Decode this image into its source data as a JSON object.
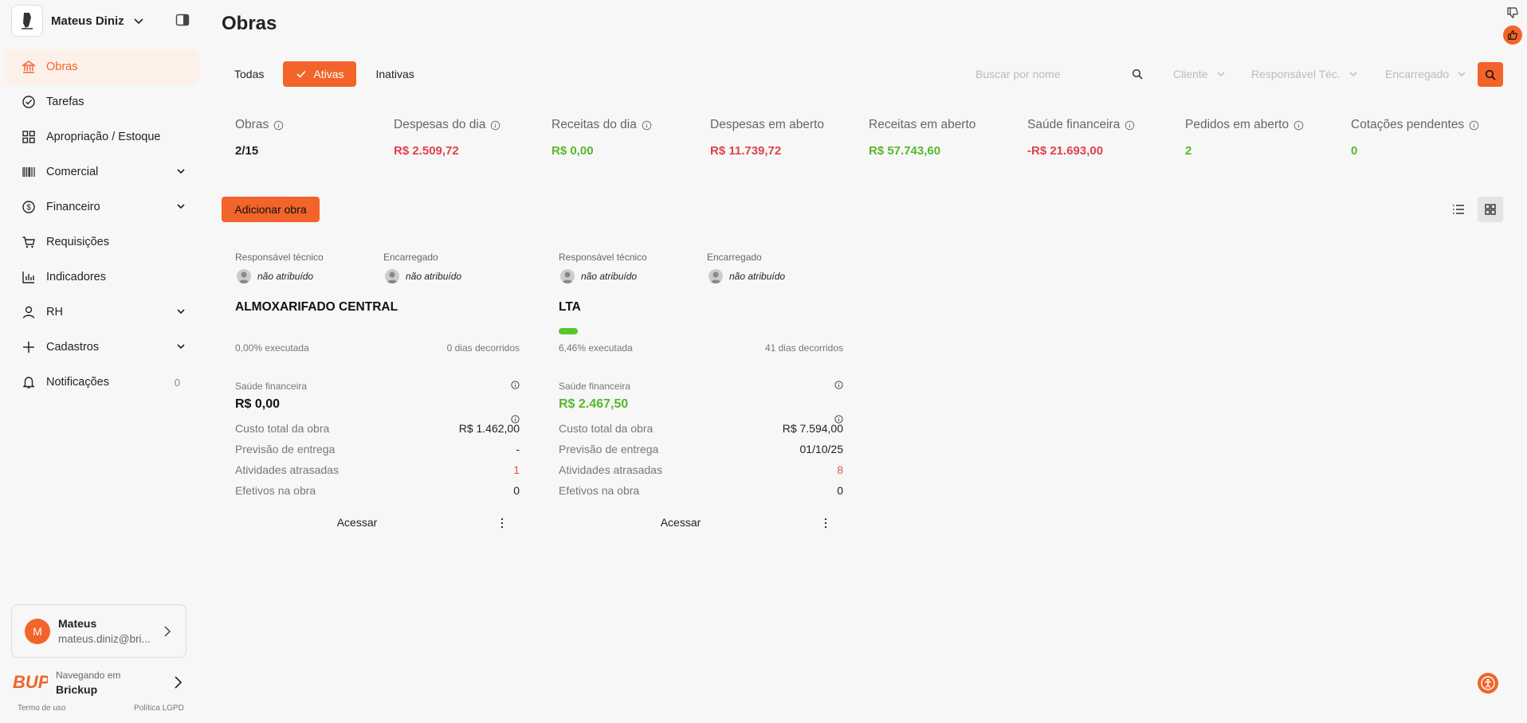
{
  "workspace": {
    "name": "Mateus Diniz"
  },
  "sidebar": {
    "items": [
      {
        "label": "Obras",
        "icon": "bank-icon",
        "active": true
      },
      {
        "label": "Tarefas",
        "icon": "check-circle-icon"
      },
      {
        "label": "Apropriação / Estoque",
        "icon": "grid-icon"
      },
      {
        "label": "Comercial",
        "icon": "barcode-icon",
        "expandable": true
      },
      {
        "label": "Financeiro",
        "icon": "dollar-circle-icon",
        "expandable": true
      },
      {
        "label": "Requisições",
        "icon": "cart-icon"
      },
      {
        "label": "Indicadores",
        "icon": "bar-chart-icon"
      },
      {
        "label": "RH",
        "icon": "user-icon",
        "expandable": true
      },
      {
        "label": "Cadastros",
        "icon": "plus-icon",
        "expandable": true
      },
      {
        "label": "Notificações",
        "icon": "bell-icon",
        "count": "0"
      }
    ],
    "user": {
      "initial": "M",
      "name": "Mateus",
      "email": "mateus.diniz@bri..."
    },
    "brand": {
      "subtitle": "Navegando em",
      "name": "Brickup",
      "logo_text": "BUP"
    },
    "footer": {
      "terms": "Termo de uso",
      "privacy": "Política LGPD"
    }
  },
  "page": {
    "title": "Obras"
  },
  "filters": {
    "tabs": [
      "Todas",
      "Ativas",
      "Inativas"
    ],
    "active_tab": "Ativas",
    "search_placeholder": "Buscar por nome",
    "cliente": "Cliente",
    "responsavel": "Responsável Téc.",
    "encarregado": "Encarregado"
  },
  "stats": [
    {
      "label": "Obras",
      "value": "2/15",
      "color": "#222222",
      "info": true
    },
    {
      "label": "Despesas do dia",
      "value": "R$ 2.509,72",
      "color": "#e0414b",
      "info": true
    },
    {
      "label": "Receitas do dia",
      "value": "R$ 0,00",
      "color": "#56b82a",
      "info": true
    },
    {
      "label": "Despesas em aberto",
      "value": "R$ 11.739,72",
      "color": "#e0414b",
      "info": false
    },
    {
      "label": "Receitas em aberto",
      "value": "R$ 57.743,60",
      "color": "#56b82a",
      "info": false
    },
    {
      "label": "Saúde financeira",
      "value": "-R$ 21.693,00",
      "color": "#e0414b",
      "info": true
    },
    {
      "label": "Pedidos em aberto",
      "value": "2",
      "color": "#56b82a",
      "info": true
    },
    {
      "label": "Cotações pendentes",
      "value": "0",
      "color": "#56b82a",
      "info": true
    }
  ],
  "actions": {
    "add_label": "Adicionar obra"
  },
  "cards": [
    {
      "resp_label": "Responsável técnico",
      "resp_name": "não atribuído",
      "enc_label": "Encarregado",
      "enc_name": "não atribuído",
      "title": "ALMOXARIFADO CENTRAL",
      "progress": 0.0,
      "executed": "0,00% executada",
      "days": "0 dias decorridos",
      "sf_label": "Saúde financeira",
      "sf_value": "R$ 0,00",
      "sf_color": "#111111",
      "rows": [
        {
          "label": "Custo total da obra",
          "value": "R$ 1.462,00"
        },
        {
          "label": "Previsão de entrega",
          "value": "-"
        },
        {
          "label": "Atividades atrasadas",
          "value": "1"
        },
        {
          "label": "Efetivos na obra",
          "value": "0"
        }
      ],
      "access": "Acessar"
    },
    {
      "resp_label": "Responsável técnico",
      "resp_name": "não atribuído",
      "enc_label": "Encarregado",
      "enc_name": "não atribuído",
      "title": "LTA",
      "progress": 0.0646,
      "executed": "6,46% executada",
      "days": "41 dias decorridos",
      "sf_label": "Saúde financeira",
      "sf_value": "R$ 2.467,50",
      "sf_color": "#56b82a",
      "rows": [
        {
          "label": "Custo total da obra",
          "value": "R$ 7.594,00"
        },
        {
          "label": "Previsão de entrega",
          "value": "01/10/25"
        },
        {
          "label": "Atividades atrasadas",
          "value": "8"
        },
        {
          "label": "Efetivos na obra",
          "value": "0"
        }
      ],
      "access": "Acessar"
    }
  ],
  "colors": {
    "accent": "#f2642a",
    "red": "#e0414b",
    "green": "#56b82a"
  }
}
